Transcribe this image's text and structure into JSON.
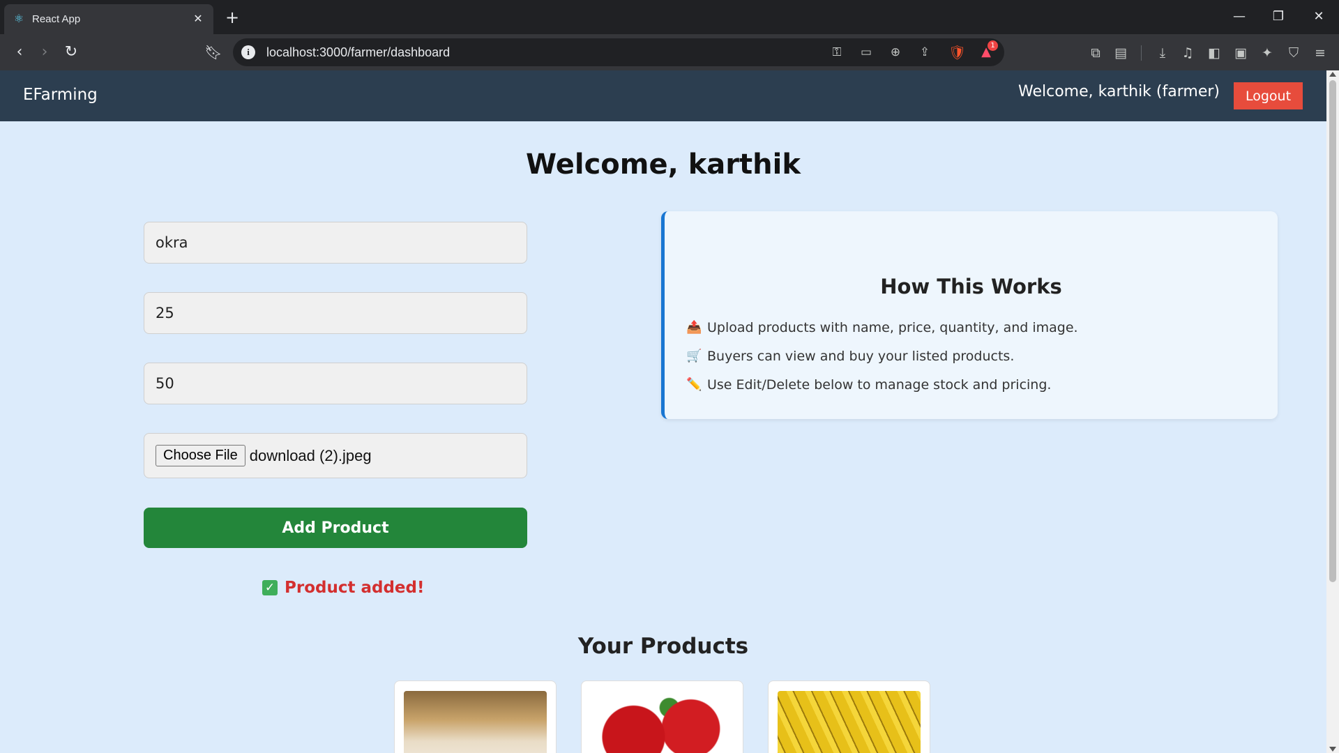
{
  "browser": {
    "tab_title": "React App",
    "url": "localhost:3000/farmer/dashboard",
    "rewards_badge": "1"
  },
  "navbar": {
    "brand": "EFarming",
    "welcome_text": "Welcome, karthik (farmer)",
    "logout_label": "Logout"
  },
  "page": {
    "title": "Welcome, karthik"
  },
  "form": {
    "name_value": "okra",
    "price_value": "25",
    "quantity_value": "50",
    "choose_file_label": "Choose File",
    "file_name": "download (2).jpeg",
    "submit_label": "Add Product",
    "status_message": "Product added!"
  },
  "info_card": {
    "title": "How This Works",
    "items": [
      {
        "icon": "inbox-tray-icon",
        "glyph": "📤",
        "text": "Upload products with name, price, quantity, and image."
      },
      {
        "icon": "cart-icon",
        "glyph": "🛒",
        "text": "Buyers can view and buy your listed products."
      },
      {
        "icon": "pencil-icon",
        "glyph": "✏️",
        "text": "Use Edit/Delete below to manage stock and pricing."
      }
    ]
  },
  "products": {
    "section_title": "Your Products",
    "items": [
      {
        "image": "rice-image"
      },
      {
        "image": "apple-image"
      },
      {
        "image": "banana-image"
      }
    ]
  },
  "colors": {
    "navbar_bg": "#2c3e50",
    "logout_bg": "#e74c3c",
    "add_button_bg": "#23863a",
    "status_text": "#d32f2f",
    "card_accent": "#1976d2",
    "page_bg": "#dcebfb"
  }
}
